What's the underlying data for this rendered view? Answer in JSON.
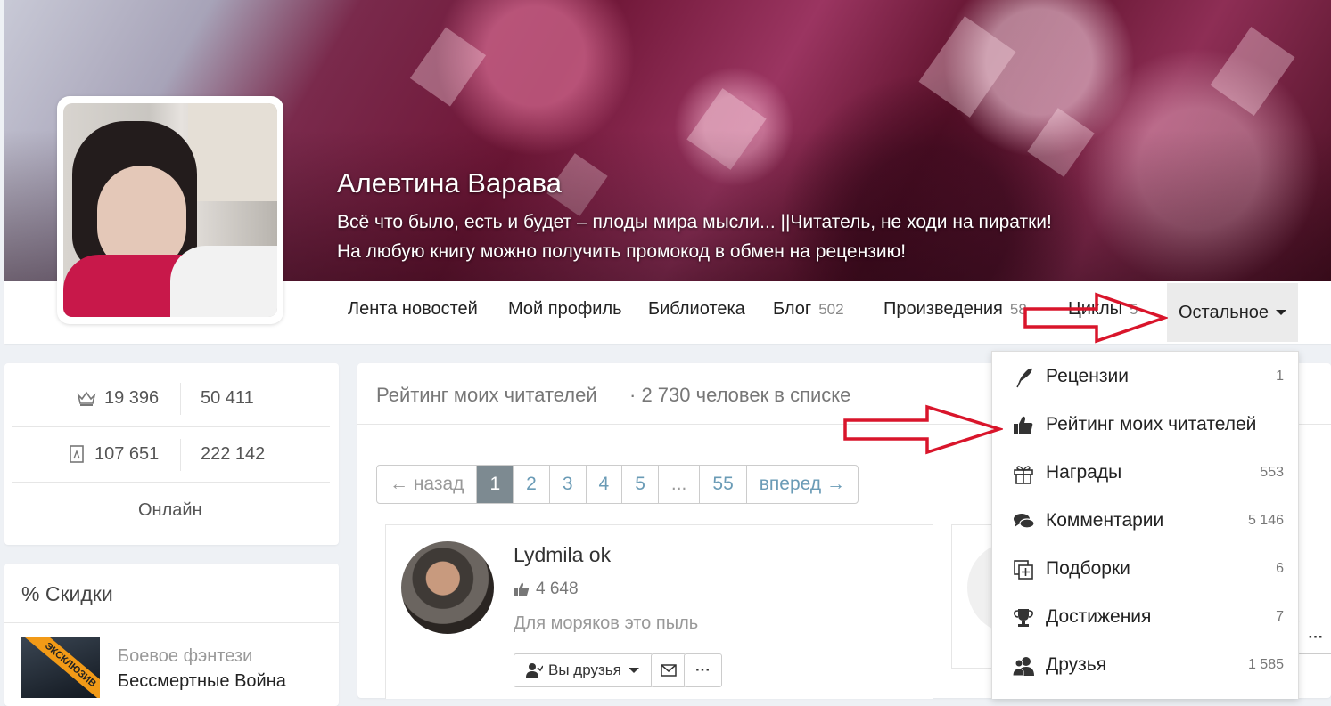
{
  "profile": {
    "name": "Алевтина Варава",
    "status": "Всё что было, есть и будет – плоды мира мысли... ||Читатель, не ходи на пиратки! На любую книгу можно получить промокод в обмен на рецензию!"
  },
  "nav": {
    "items": [
      {
        "label": "Лента новостей"
      },
      {
        "label": "Мой профиль"
      },
      {
        "label": "Библиотека"
      },
      {
        "label": "Блог",
        "count": "502"
      },
      {
        "label": "Произведения",
        "count": "58"
      },
      {
        "label": "Циклы",
        "count": "5"
      }
    ],
    "more_label": "Остальное"
  },
  "stats": {
    "crown_value": "19 396",
    "second_value": "50 411",
    "book_value": "107 651",
    "fourth_value": "222 142",
    "online_label": "Онлайн"
  },
  "discounts": {
    "title": "% Скидки",
    "badge": "ЭКСКЛЮЗИВ",
    "genre": "Боевое фэнтези",
    "book_title": "Бессмертные Война"
  },
  "main": {
    "title": "Рейтинг моих читателей",
    "count_text": "· 2 730 человек в списке",
    "pager": {
      "prev": "← назад",
      "pages": [
        "1",
        "2",
        "3",
        "4",
        "5",
        "...",
        "55"
      ],
      "next": "вперед →",
      "active": "1"
    },
    "reader": {
      "name": "Lydmila ok",
      "likes": "4 648",
      "quote": "Для моряков это пыль",
      "friends_button": "Вы друзья",
      "more": "···"
    },
    "side_more": "···"
  },
  "dropdown": {
    "items": [
      {
        "label": "Рецензии",
        "count": "1",
        "icon": "quill-icon"
      },
      {
        "label": "Рейтинг моих читателей",
        "count": "",
        "icon": "thumbs-up-icon"
      },
      {
        "label": "Награды",
        "count": "553",
        "icon": "gift-icon"
      },
      {
        "label": "Комментарии",
        "count": "5 146",
        "icon": "comments-icon"
      },
      {
        "label": "Подборки",
        "count": "6",
        "icon": "collections-icon"
      },
      {
        "label": "Достижения",
        "count": "7",
        "icon": "trophy-icon"
      },
      {
        "label": "Друзья",
        "count": "1 585",
        "icon": "friends-icon"
      }
    ]
  },
  "colors": {
    "annotation_arrow": "#d9152b",
    "pager_active": "#7d8a91",
    "link": "#6a9bb6"
  }
}
